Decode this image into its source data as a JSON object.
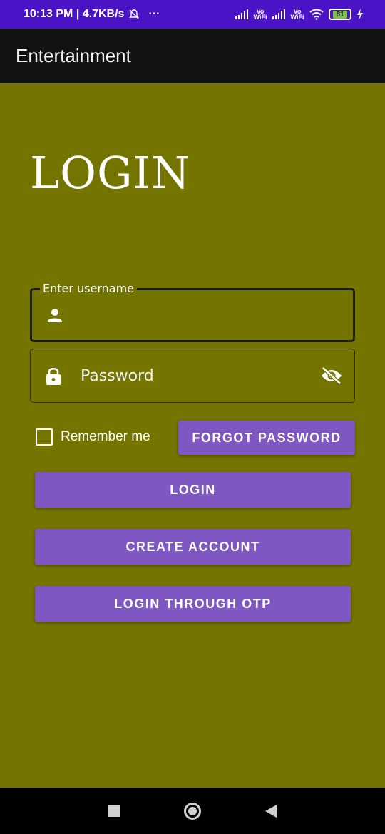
{
  "status_bar": {
    "time_speed": "10:13 PM | 4.7KB/s",
    "more": "···",
    "vo_wifi_1": "Vo WiFi",
    "vo_wifi_2": "Vo WiFi",
    "battery": "81",
    "icons": [
      "bell-off-icon",
      "signal-icon",
      "wifi-icon",
      "battery-icon",
      "charging-icon"
    ]
  },
  "app_bar": {
    "title": "Entertainment"
  },
  "screen_title": "LOGIN",
  "username": {
    "label": "Enter username",
    "value": ""
  },
  "password": {
    "placeholder": "Password",
    "value": ""
  },
  "remember": {
    "label": "Remember me",
    "checked": false
  },
  "buttons": {
    "forgot": "FORGOT PASSWORD",
    "login": "LOGIN",
    "create": "CREATE ACCOUNT",
    "otp": "LOGIN THROUGH OTP"
  },
  "colors": {
    "background": "#737500",
    "status_bar": "#4a14c6",
    "app_bar": "#121212",
    "button": "#7e57c2",
    "nav_bar": "#000000"
  }
}
